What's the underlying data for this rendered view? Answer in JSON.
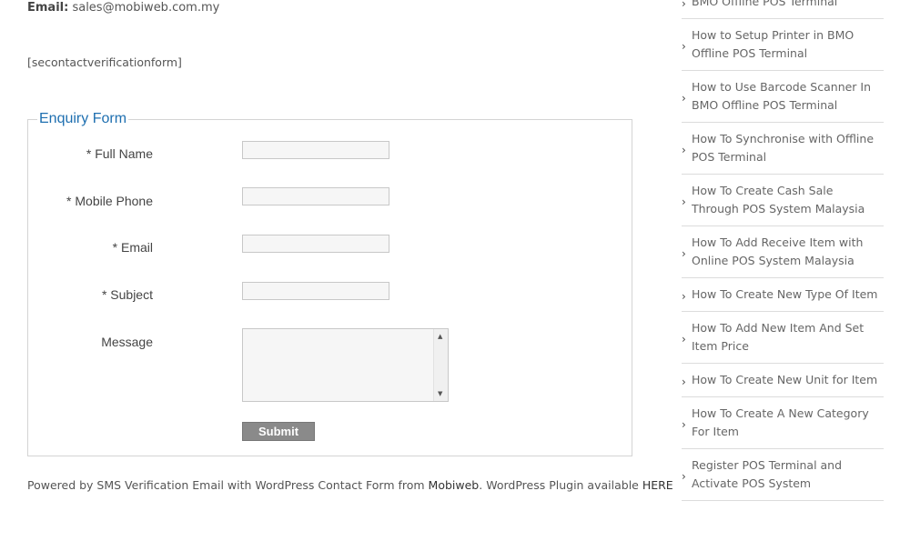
{
  "contact": {
    "email_label": "Email:",
    "email_value": "sales@mobiweb.com.my",
    "shortcode": "[secontactverificationform]"
  },
  "form": {
    "legend": "Enquiry Form",
    "full_name_label": "* Full Name",
    "mobile_label": "* Mobile Phone",
    "email_label": "* Email",
    "subject_label": "* Subject",
    "message_label": "Message",
    "submit_label": "Submit"
  },
  "footer": {
    "powered_prefix": "Powered by SMS Verification Email with WordPress Contact Form from ",
    "mobiweb_link": "Mobiweb",
    "powered_middle": ". WordPress Plugin available ",
    "here_link": "HERE"
  },
  "sidebar": {
    "items": [
      {
        "label": "BMO Offline POS Terminal"
      },
      {
        "label": "How to Setup Printer in BMO Offline POS Terminal"
      },
      {
        "label": "How to Use Barcode Scanner In BMO Offline POS Terminal"
      },
      {
        "label": "How To Synchronise with Offline POS Terminal"
      },
      {
        "label": "How To Create Cash Sale Through POS System Malaysia"
      },
      {
        "label": "How To Add Receive Item with Online POS System Malaysia"
      },
      {
        "label": "How To Create New Type Of Item"
      },
      {
        "label": "How To Add New Item And Set Item Price"
      },
      {
        "label": "How To Create New Unit for Item"
      },
      {
        "label": "How To Create A New Category For Item"
      },
      {
        "label": "Register POS Terminal and Activate POS System"
      }
    ]
  },
  "icons": {
    "sidebar_bullet": "chevron-right-icon",
    "textarea_scroll_up": "arrow-up-icon",
    "textarea_scroll_down": "arrow-down-icon"
  }
}
